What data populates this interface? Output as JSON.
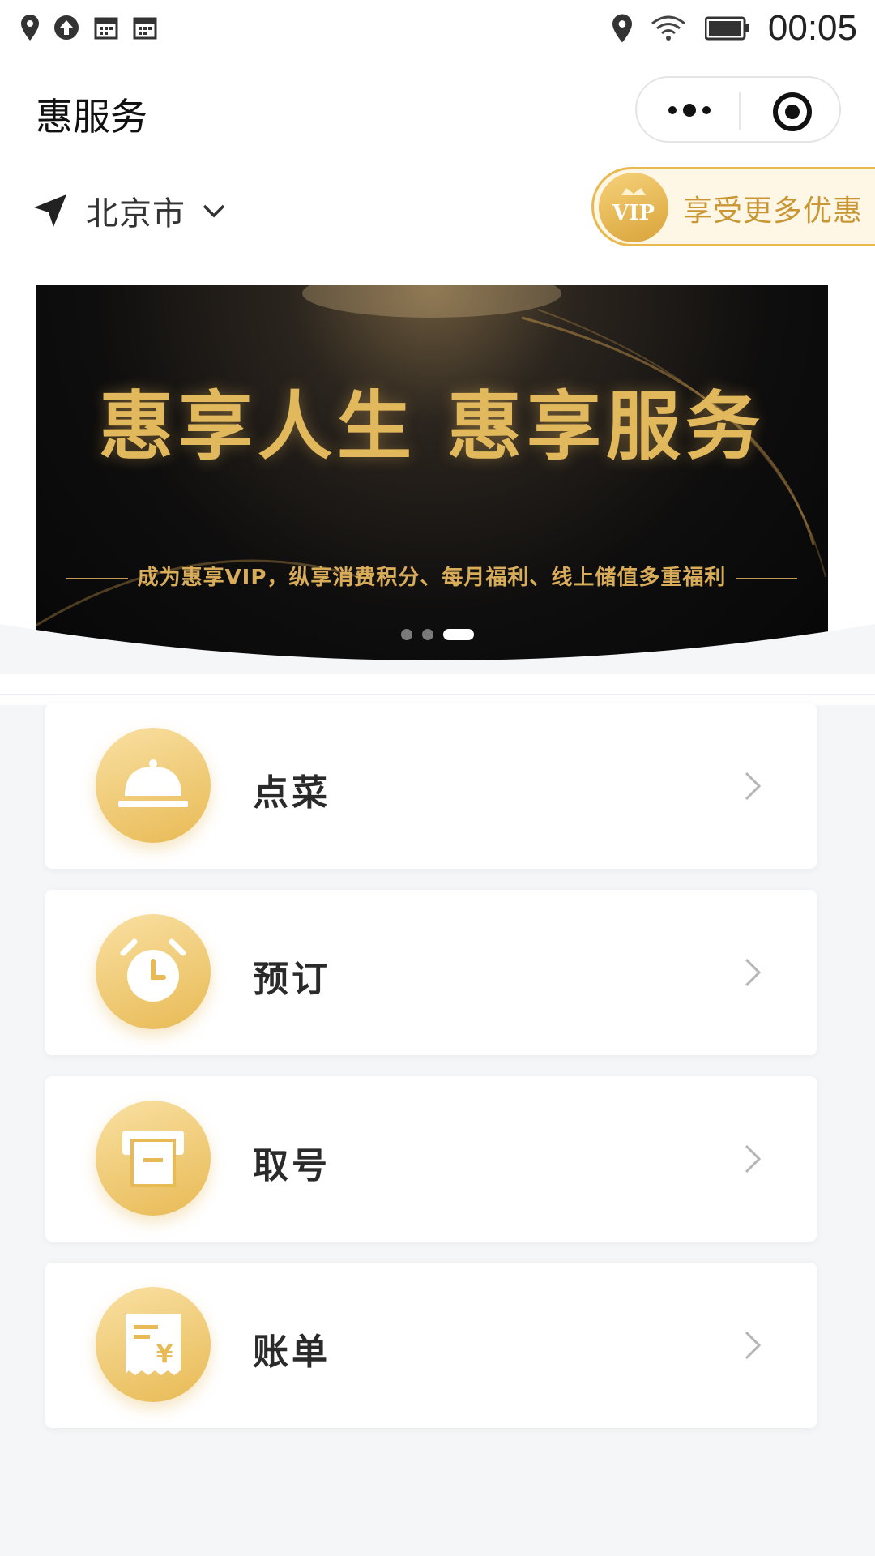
{
  "status_bar": {
    "left_icons": [
      "location-pin-icon",
      "upload-circle-icon",
      "calendar-icon",
      "calendar-icon"
    ],
    "right_icons": [
      "location-pin-icon",
      "wifi-icon",
      "battery-icon"
    ],
    "time": "00:05"
  },
  "header": {
    "title": "惠服务",
    "more_icon": "more-dots-icon",
    "close_icon": "target-close-icon"
  },
  "location": {
    "city": "北京市",
    "icon": "navigation-arrow-icon",
    "dropdown_icon": "chevron-down-icon"
  },
  "vip_promo": {
    "badge_text": "VIP",
    "text": "享受更多优惠"
  },
  "banner": {
    "title": "惠享人生 惠享服务",
    "subtitle": "成为惠享VIP，纵享消费积分、每月福利、线上储值多重福利",
    "slide_count": 3,
    "active_slide": 3
  },
  "menu": [
    {
      "label": "点菜",
      "icon": "service-bell-icon"
    },
    {
      "label": "预订",
      "icon": "alarm-clock-icon"
    },
    {
      "label": "取号",
      "icon": "ticket-printer-icon"
    },
    {
      "label": "账单",
      "icon": "bill-yuan-icon"
    }
  ],
  "colors": {
    "accent_gold": "#e8b94f",
    "vip_text": "#c99634",
    "page_bg": "#f5f6f8"
  }
}
